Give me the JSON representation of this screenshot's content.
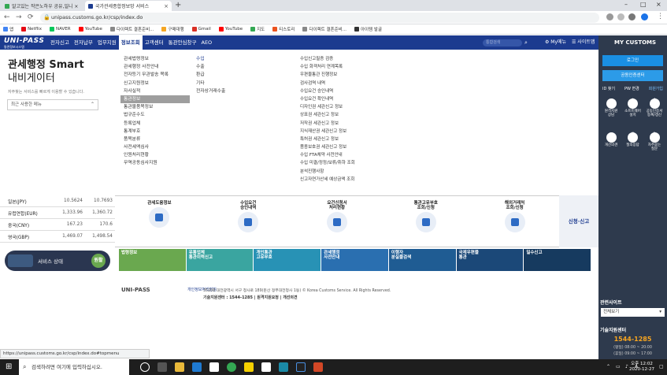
{
  "browser": {
    "tabs": [
      {
        "label": "알고있는 작은노하우 공유,일니 ×",
        "favicon_color": "#34a853"
      },
      {
        "label": "국가관세종합정보망 서비스",
        "favicon_color": "#1c3b8f"
      }
    ],
    "url": "unipass.customs.go.kr/csp/index.do",
    "bookmarks": [
      {
        "label": "앱",
        "color": "#4285f4"
      },
      {
        "label": "Netflix",
        "color": "#e50914"
      },
      {
        "label": "NAVER",
        "color": "#03c75a"
      },
      {
        "label": "YouTube",
        "color": "#ff0000"
      },
      {
        "label": "다이렉트 결혼준비...",
        "color": "#888888"
      },
      {
        "label": "구매대행",
        "color": "#f5a623"
      },
      {
        "label": "Gmail",
        "color": "#d93025"
      },
      {
        "label": "YouTube",
        "color": "#ff0000"
      },
      {
        "label": "지도",
        "color": "#34a853"
      },
      {
        "label": "티스토리",
        "color": "#eb531f"
      },
      {
        "label": "다이렉트 결혼준비...",
        "color": "#888888"
      },
      {
        "label": "아이템 발굴",
        "color": "#333333"
      }
    ]
  },
  "site": {
    "logo": "UNI-PASS",
    "logo_sub": "통관정보시스템",
    "nav": [
      "전자신고",
      "전자납부",
      "업무지원",
      "정보조회",
      "고객센터",
      "통관안심창구",
      "AEO"
    ],
    "nav_active": "정보조회",
    "search_placeholder": "통합검색",
    "my_menu": "My메뉴",
    "sitemap": "사이트맵",
    "accent": "#1c3b8f"
  },
  "main": {
    "title_line1": "관세행정 Smart",
    "title_line2": "내비게이터",
    "subtext": "자주찾는 서비스를 빠르게 이용할 수 있습니다.",
    "recent_select": "최근 사용한 메뉴",
    "col1": [
      "관세법령정보",
      "관세행정 사전안내",
      "전자등기 무관발송 목록",
      "신고지원정보",
      "자사실적",
      "통관정보",
      "통관물품목정보",
      "법규준수도",
      "등록업체",
      "통계부호",
      "품목분류",
      "사전세액심사",
      "인원처리현황",
      "무역공동심사지원"
    ],
    "col1_selected": "통관정보",
    "col2": [
      "수입",
      "수출",
      "환급",
      "기타",
      "전자상거래수출"
    ],
    "col3": [
      "수입신고필증 검증",
      "수입 화객처리 연계목록",
      "우편물통관 진행정보",
      "검사검역 내역",
      "수입요건 승인내역",
      "수입요건 확인내역",
      "디자인권 세관신고 정보",
      "상표권 세관신고 정보",
      "저작권 세관신고 정보",
      "지식재산권 세관신고 정보",
      "특허권 세관신고 정보",
      "품종보호권 세관신고 정보",
      "수입 FTA체약 사전안내",
      "수입 미결/정정/보류/취하 조회",
      "분석진행사항",
      "신고자연가산세 예상금액 조회"
    ]
  },
  "exchange": [
    {
      "currency": "일본(JPY)",
      "a": "10.5624",
      "b": "10.7693"
    },
    {
      "currency": "유럽연합(EUR)",
      "a": "1,333.96",
      "b": "1,360.72"
    },
    {
      "currency": "중국(CNY)",
      "a": "167.23",
      "b": "170.6"
    },
    {
      "currency": "영국(GBP)",
      "a": "1,469.07",
      "b": "1,498.54"
    }
  ],
  "services": [
    {
      "label": "관세도움정보"
    },
    {
      "label": "수입요건\n승인내역"
    },
    {
      "label": "요건신청서\n처리현황"
    },
    {
      "label": "통관고유부호\n조회/신청"
    },
    {
      "label": "해외거래처\n조회/신청"
    }
  ],
  "services_side": "신청·신고",
  "service_status": {
    "label": "서비스 상태",
    "state": "원활"
  },
  "banners": [
    {
      "label": "법령정보",
      "color": "#6aa84f"
    },
    {
      "label": "유통업체\n통관이력신고",
      "color": "#3aa5a0"
    },
    {
      "label": "개인통관\n고유부호",
      "color": "#2892b5"
    },
    {
      "label": "관세행정\n사전안내",
      "color": "#2a6fb0"
    },
    {
      "label": "이행자\n분실물검색",
      "color": "#1f5c93"
    },
    {
      "label": "국제우편물\n통관",
      "color": "#1b4878"
    },
    {
      "label": "밀수신고",
      "color": "#163a5f"
    }
  ],
  "footer": {
    "logo": "UNI-PASS",
    "privacy": "개인정보처리방침",
    "address": "35208 대전광역시 서구 청사로 189(둔산 정부대전청사 1동)   © Korea Customs Service. All Rights Reserved.",
    "phone_label": "기술지원센터 : 1544-1285  |  원격지원요청  |  개선의견"
  },
  "right_panel": {
    "title": "MY CUSTOMS",
    "login": "로그인",
    "cert": "공동인증센터",
    "links": [
      "ID 찾기",
      "PW 변경",
      "회원가입"
    ],
    "grid1": [
      "원격지원\n상담",
      "소프트웨어\n설치",
      "공동인증서\n등록/갱신"
    ],
    "grid2": [
      "개선의견",
      "질의응답",
      "자주묻는\n질문"
    ],
    "related_title": "관련사이트",
    "related_select": "전체보기",
    "support_title": "기술지원센터",
    "phone": "1544-1285",
    "hours1": "(평일) 08:00 ~ 20:00",
    "hours2": "(휴일) 09:00 ~ 17:00"
  },
  "status_url": "https://unipass.customs.go.kr/csp/index.do#topmenu",
  "taskbar": {
    "search": "검색하려면 여기에 입력하십시오.",
    "time": "오후 12:02",
    "date": "2020-12-27"
  }
}
